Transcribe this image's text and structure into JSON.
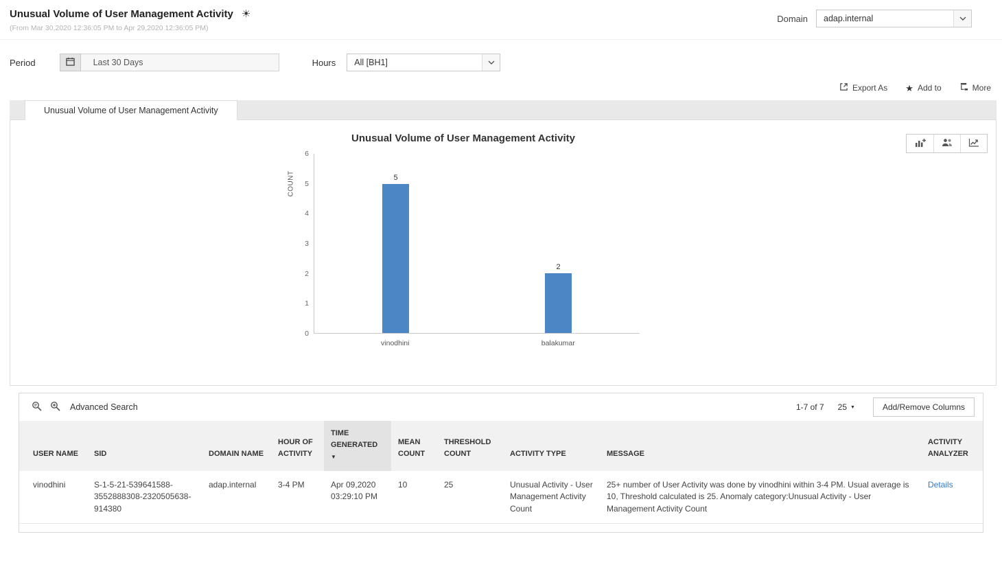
{
  "colors": {
    "bar": "#4d86c4",
    "link": "#2b7bd3"
  },
  "icons": {
    "insights": "☀",
    "star": "★",
    "sort_desc": "▼",
    "caret_down": "▼"
  },
  "header": {
    "title": "Unusual Volume of User Management Activity",
    "subtitle": "(From Mar 30,2020 12:36:05 PM to Apr 29,2020 12:36:05 PM)",
    "domain_label": "Domain",
    "domain_value": "adap.internal"
  },
  "filters": {
    "period_label": "Period",
    "period_value": "Last 30 Days",
    "hours_label": "Hours",
    "hours_value": "All [BH1]"
  },
  "actions": {
    "export_as": "Export As",
    "add_to": "Add to",
    "more": "More"
  },
  "tab": {
    "label": "Unusual Volume of User Management Activity"
  },
  "chart_data": {
    "type": "bar",
    "title": "Unusual Volume of User Management Activity",
    "categories": [
      "vinodhini",
      "balakumar"
    ],
    "values": [
      5,
      2
    ],
    "xlabel": "",
    "ylabel": "COUNT",
    "ylim": [
      0,
      6
    ],
    "y_tick_step": 1,
    "grid": false,
    "legend": false,
    "bar_color": "#4d86c4"
  },
  "table": {
    "advanced_search_label": "Advanced Search",
    "pagination": "1-7 of 7",
    "page_size": "25",
    "add_remove_columns_label": "Add/Remove Columns",
    "columns": [
      "USER NAME",
      "SID",
      "DOMAIN NAME",
      "HOUR OF ACTIVITY",
      "TIME GENERATED",
      "MEAN COUNT",
      "THRESHOLD COUNT",
      "ACTIVITY TYPE",
      "MESSAGE",
      "ACTIVITY ANALYZER"
    ],
    "sorted_column": "TIME GENERATED",
    "sort_direction": "desc",
    "rows": [
      {
        "user_name": "vinodhini",
        "sid": "S-1-5-21-539641588-3552888308-2320505638-914380",
        "domain_name": "adap.internal",
        "hour_of_activity": "3-4 PM",
        "time_generated": "Apr 09,2020 03:29:10 PM",
        "mean_count": "10",
        "threshold_count": "25",
        "activity_type": "Unusual Activity - User Management Activity Count",
        "message": "25+ number of User Activity was done by vinodhini within 3-4 PM. Usual average is 10, Threshold calculated is 25. Anomaly category:Unusual Activity - User Management Activity Count",
        "activity_analyzer_label": "Details"
      }
    ]
  }
}
